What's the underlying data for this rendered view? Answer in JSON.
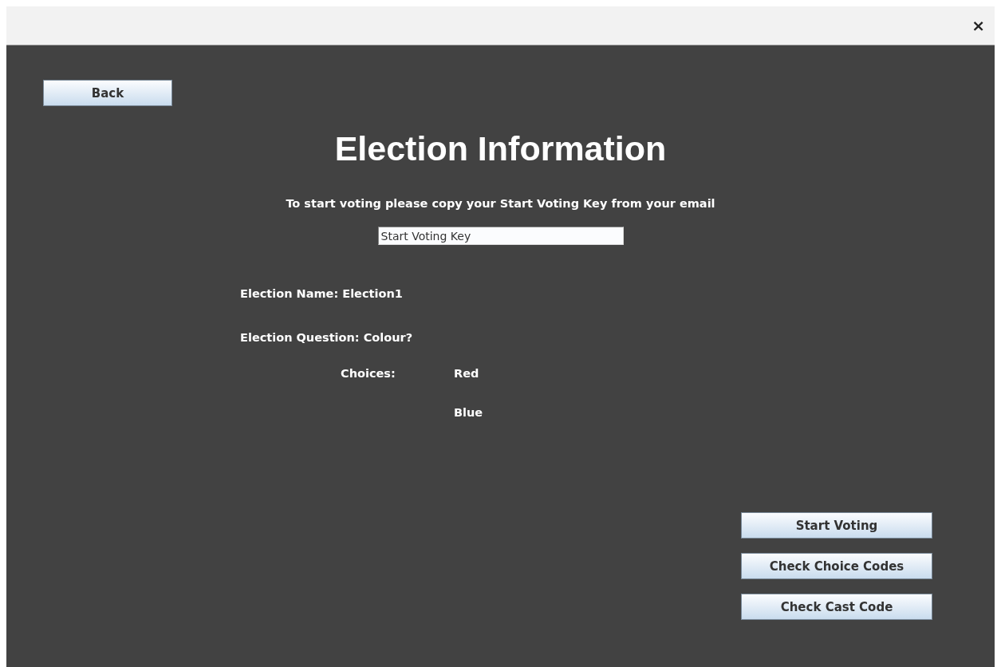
{
  "window": {
    "close_label": "×"
  },
  "back_button": "Back",
  "title": "Election Information",
  "instruction": "To start voting please copy your Start Voting Key from your email",
  "key_field": {
    "value": "Start Voting Key"
  },
  "election_name": "Election Name: Election1",
  "election_question": "Election Question: Colour?",
  "choices": {
    "label": "Choices:",
    "items": [
      "Red",
      "Blue"
    ]
  },
  "actions": [
    "Start Voting",
    "Check Choice Codes",
    "Check Cast Code"
  ]
}
